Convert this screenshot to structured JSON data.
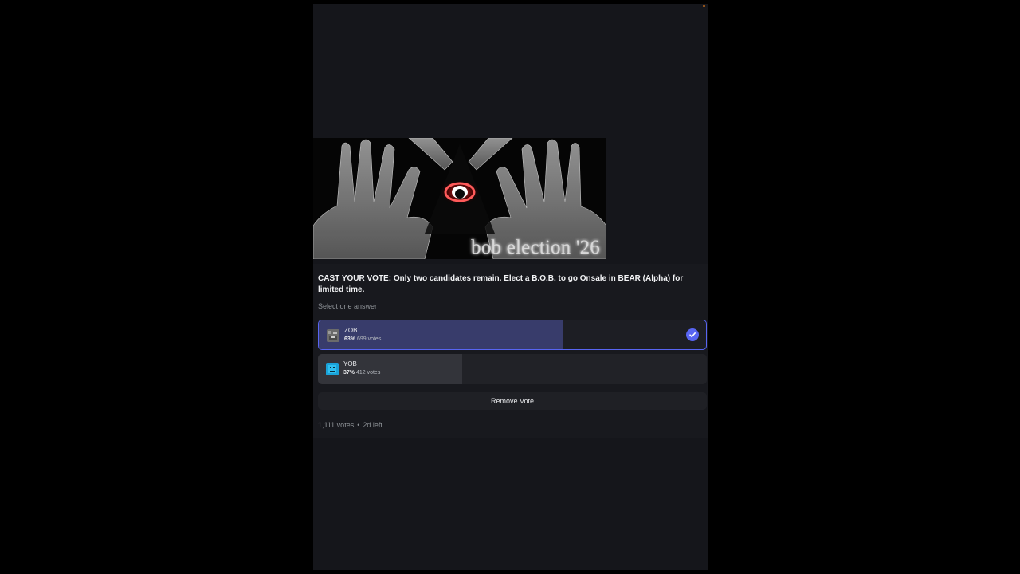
{
  "embed": {
    "image_caption": "bob election '26"
  },
  "poll": {
    "question": "CAST YOUR VOTE: Only two candidates remain. Elect a B.O.B. to go Onsale in BEAR (Alpha) for limited time.",
    "hint": "Select one answer",
    "answers": [
      {
        "name": "ZOB",
        "percent_label": "63%",
        "votes_label": "699 votes",
        "percent": 63,
        "selected": true
      },
      {
        "name": "YOB",
        "percent_label": "37%",
        "votes_label": "412 votes",
        "percent": 37,
        "selected": false
      }
    ],
    "remove_vote_label": "Remove Vote",
    "total_votes": "1,111 votes",
    "separator": "•",
    "time_left": "2d left"
  },
  "colors": {
    "accent": "#5865f2",
    "selected_fill": "#383c6b",
    "background": "#15161b"
  },
  "icons": {
    "selected_check": "checkmark-icon",
    "zob_avatar": "pixel-avatar-icon",
    "yob_avatar": "blue-avatar-icon"
  }
}
